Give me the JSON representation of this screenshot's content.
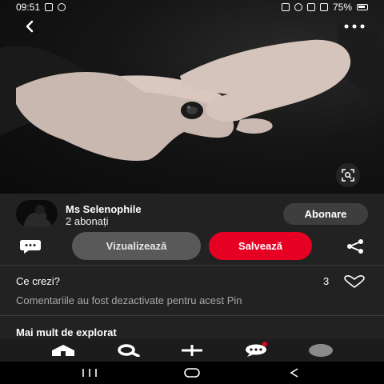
{
  "status_bar": {
    "time": "09:51",
    "battery": "75%"
  },
  "pin": {
    "creator": {
      "name": "Ms Selenophile",
      "followers": "2 abonați",
      "follow_label": "Abonare"
    },
    "actions": {
      "visit_label": "Vizualizează",
      "save_label": "Salvează"
    },
    "comments": {
      "title": "Ce crezi?",
      "count": "3",
      "disabled_text": "Comentariile au fost dezactivate pentru acest Pin"
    },
    "explore_title": "Mai mult de explorat"
  },
  "tab_bar": {
    "items": [
      {
        "icon": "home-icon"
      },
      {
        "icon": "search-icon"
      },
      {
        "icon": "plus-icon"
      },
      {
        "icon": "messages-icon"
      },
      {
        "icon": "profile-icon"
      }
    ]
  },
  "system_nav": {
    "items": [
      {
        "icon": "recents-icon"
      },
      {
        "icon": "home-circle-icon"
      },
      {
        "icon": "back-chevron-icon"
      }
    ]
  },
  "colors": {
    "accent": "#e60023",
    "panel": "#222222",
    "secondary_button": "#595959"
  }
}
